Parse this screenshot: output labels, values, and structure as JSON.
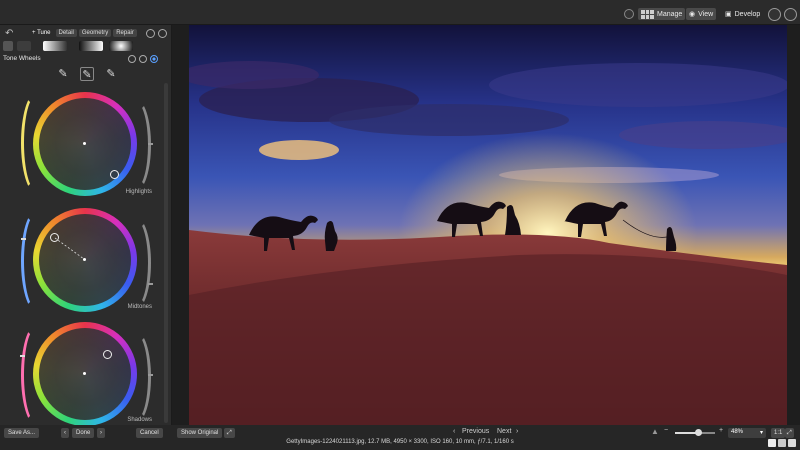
{
  "topbar": {
    "manage_label": "Manage",
    "view_label": "View",
    "develop_label": "Develop",
    "icons": [
      "user-icon",
      "grid-icon",
      "eye-icon",
      "develop-icon",
      "circle-icon",
      "eye-settings-icon"
    ]
  },
  "panel": {
    "tabs": [
      {
        "label": "+ Tune",
        "active": true
      },
      {
        "label": "Detail",
        "active": false
      },
      {
        "label": "Geometry",
        "active": false
      },
      {
        "label": "Repair",
        "active": false
      }
    ],
    "section_title": "Tone Wheels",
    "wheels": [
      {
        "label": "Highlights",
        "arc_color": "#f2e26a"
      },
      {
        "label": "Midtones",
        "arc_color": "#6fa6ff"
      },
      {
        "label": "Shadows",
        "arc_color": "#ff6fb0"
      }
    ]
  },
  "bottombar": {
    "save_as_label": "Save As...",
    "done_label": "Done",
    "cancel_label": "Cancel",
    "show_original_label": "Show Original",
    "previous_label": "Previous",
    "next_label": "Next",
    "zoom_value": "48%",
    "fit_label": "1:1",
    "file_info": "GettyImages-1224021113.jpg, 12.7 MB, 4950 × 3300, ISO 160, 10 mm, ƒ/7.1, 1/160 s",
    "zoom_slider_level": 0.58
  },
  "colors": {
    "accent": "#5aa0ff",
    "panel_bg": "#2c2c2c",
    "topbar_bg": "#2b2b2b"
  }
}
